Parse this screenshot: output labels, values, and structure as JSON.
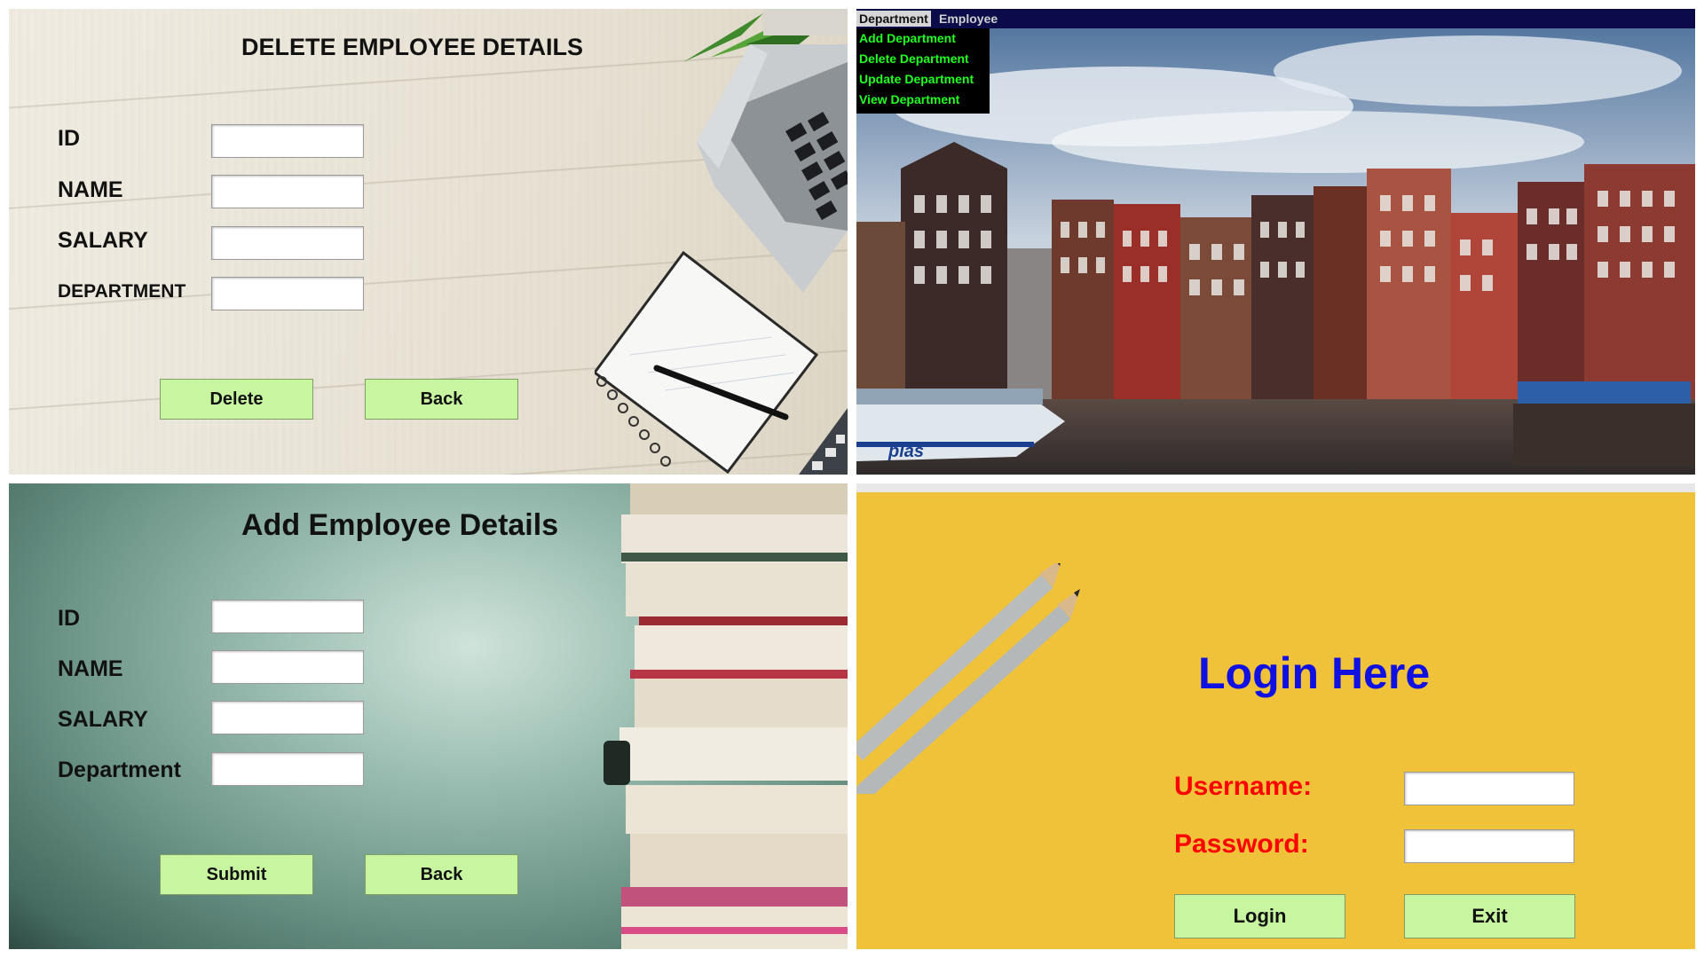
{
  "delete_form": {
    "title": "DELETE EMPLOYEE DETAILS",
    "labels": {
      "id": "ID",
      "name": "NAME",
      "salary": "SALARY",
      "department": "DEPARTMENT"
    },
    "buttons": {
      "delete": "Delete",
      "back": "Back"
    }
  },
  "department_menu": {
    "tabs": [
      "Department",
      "Employee"
    ],
    "items": [
      "Add Department",
      "Delete Department",
      "Update Department",
      "View Department"
    ],
    "boat_text": "plas"
  },
  "add_form": {
    "title": "Add Employee Details",
    "labels": {
      "id": "ID",
      "name": "NAME",
      "salary": "SALARY",
      "department": "Department"
    },
    "buttons": {
      "submit": "Submit",
      "back": "Back"
    }
  },
  "login": {
    "title": "Login Here",
    "username_label": "Username:",
    "password_label": "Password:",
    "buttons": {
      "login": "Login",
      "exit": "Exit"
    }
  },
  "colors": {
    "button_bg": "#c8f5a0",
    "menu_bar": "#0b0b4a",
    "menu_item_text": "#22ff22",
    "login_title": "#1010e0",
    "login_labels": "#ff0000",
    "login_bg": "#efc23a"
  }
}
